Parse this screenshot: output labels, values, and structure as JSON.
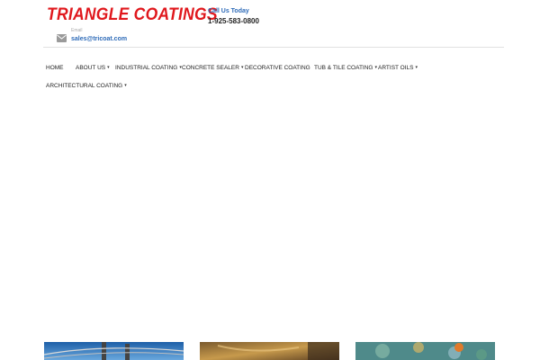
{
  "header": {
    "logo_text": "TRIANGLE COATINGS",
    "call_label": "Call Us Today",
    "phone": "1-925-583-0800",
    "email_label": "Email",
    "email": "sales@tricoat.com",
    "colors": {
      "brand": "#e0181d",
      "link": "#2e6bb8"
    }
  },
  "nav": {
    "items": [
      {
        "label": "HOME"
      },
      {
        "label": "ABOUT US",
        "caret": "▾"
      },
      {
        "label": "INDUSTRIAL COATING",
        "caret": "▾"
      },
      {
        "label": "CONCRETE SEALER",
        "caret": "▾"
      },
      {
        "label": "DECORATIVE COATING"
      },
      {
        "label": "TUB & TILE COATING",
        "caret": "▾"
      },
      {
        "label": "ARTIST OILS",
        "caret": "▾"
      },
      {
        "label": "ARCHITECTURAL COATING",
        "caret": "▾"
      }
    ]
  },
  "gallery": {
    "images": [
      {
        "name": "bridge-photo"
      },
      {
        "name": "stained-concrete-photo"
      },
      {
        "name": "decorative-floor-photo"
      }
    ]
  }
}
